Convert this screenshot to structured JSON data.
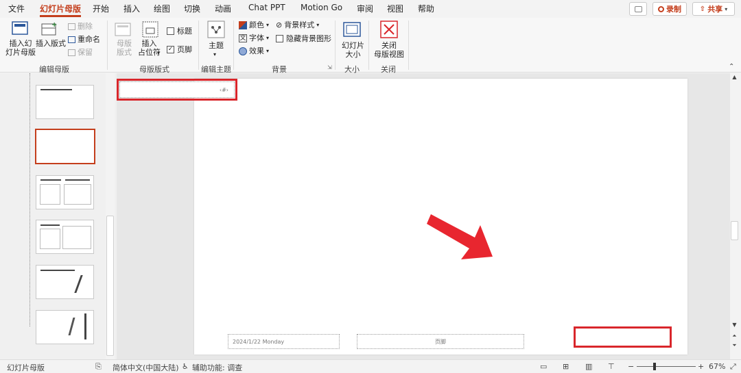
{
  "tabs": [
    "文件",
    "幻灯片母版",
    "开始",
    "插入",
    "绘图",
    "切换",
    "动画",
    "Chat PPT",
    "Motion Go",
    "审阅",
    "视图",
    "帮助"
  ],
  "top_buttons": {
    "record": "录制",
    "share": "共享"
  },
  "ribbon": {
    "insert_master": "插入幻\n灯片母版",
    "insert_layout": "插入版式",
    "delete": "删除",
    "rename": "重命名",
    "preserve": "保留",
    "group_edit_master": "编辑母版",
    "master_layout": "母版\n版式",
    "insert_placeholder": "插入\n占位符",
    "title_cb": "标题",
    "footer_cb": "页脚",
    "group_master_layout": "母版版式",
    "themes": "主题",
    "group_edit_theme": "编辑主题",
    "colors": "颜色",
    "fonts": "字体",
    "effects": "效果",
    "bg_styles": "背景样式",
    "hide_bg": "隐藏背景图形",
    "group_background": "背景",
    "slide_size": "幻灯片\n大小",
    "group_size": "大小",
    "close_master": "关闭\n母版视图",
    "group_close": "关闭"
  },
  "slide": {
    "page_number": "‹#›",
    "date": "2024/1/22  Monday",
    "footer": "页脚"
  },
  "status": {
    "view": "幻灯片母版",
    "language": "简体中文(中国大陆)",
    "accessibility": "辅助功能: 调查",
    "zoom": "67%"
  },
  "colors": {
    "accent": "#c43e1c",
    "highlight": "#d9262b"
  }
}
